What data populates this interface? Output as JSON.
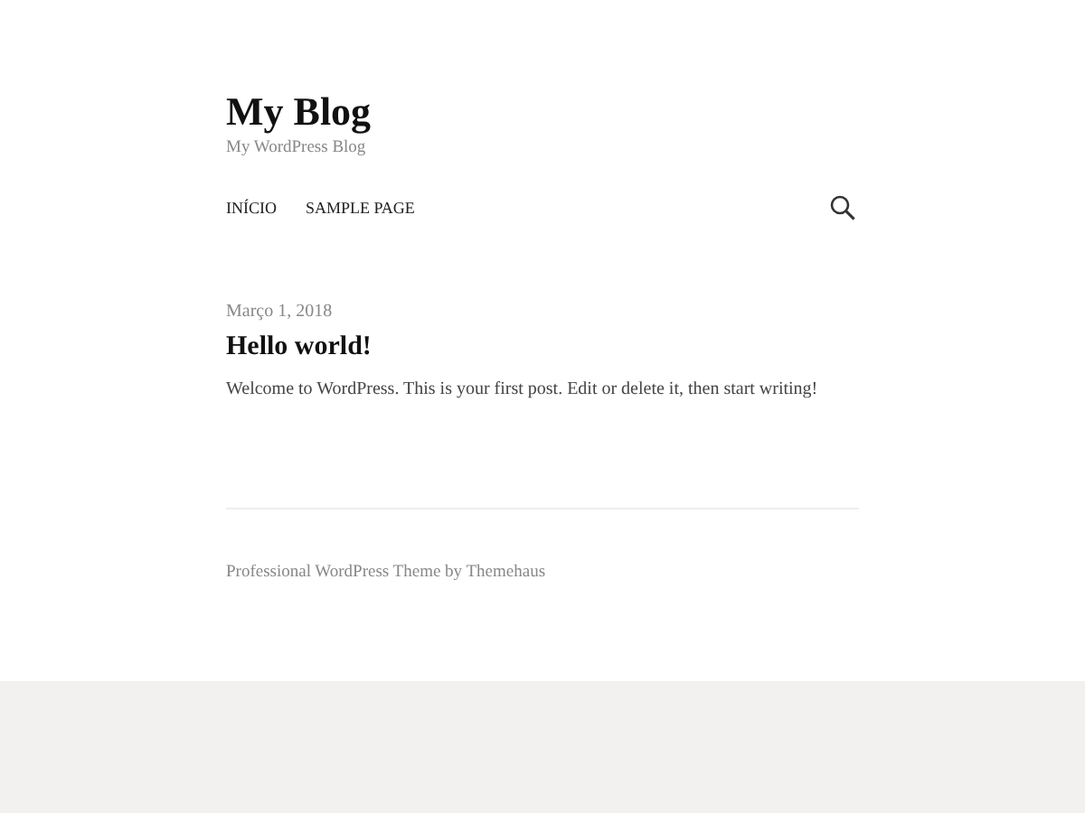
{
  "site": {
    "title": "My Blog",
    "tagline": "My WordPress Blog"
  },
  "nav": {
    "items": [
      {
        "label": "INÍCIO"
      },
      {
        "label": "SAMPLE PAGE"
      }
    ]
  },
  "post": {
    "date": "Março 1, 2018",
    "title": "Hello world!",
    "excerpt": "Welcome to WordPress. This is your first post. Edit or delete it, then start writing!"
  },
  "footer": {
    "credit": "Professional WordPress Theme by Themehaus"
  }
}
